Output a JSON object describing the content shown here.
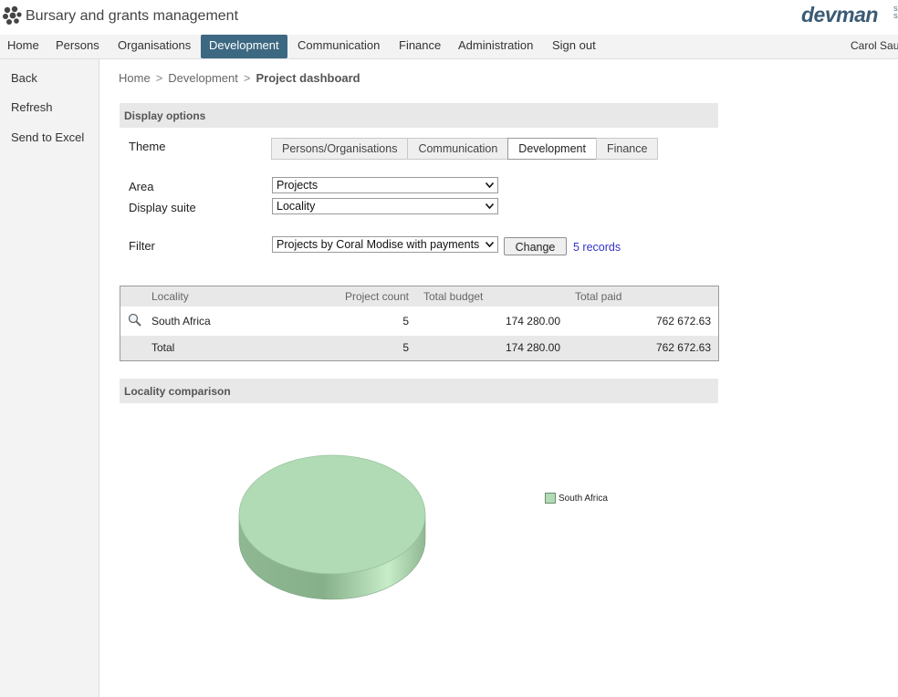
{
  "app": {
    "title": "Bursary and grants management",
    "brand": "devman",
    "brand_suffix": "S S"
  },
  "nav": {
    "items": [
      {
        "label": "Home",
        "active": false
      },
      {
        "label": "Persons",
        "active": false
      },
      {
        "label": "Organisations",
        "active": false
      },
      {
        "label": "Development",
        "active": true
      },
      {
        "label": "Communication",
        "active": false
      },
      {
        "label": "Finance",
        "active": false
      },
      {
        "label": "Administration",
        "active": false
      },
      {
        "label": "Sign out",
        "active": false
      }
    ],
    "user": "Carol Sau"
  },
  "sidebar": {
    "items": [
      "Back",
      "Refresh",
      "Send to Excel"
    ]
  },
  "breadcrumb": {
    "items": [
      "Home",
      "Development"
    ],
    "current": "Project dashboard",
    "separator": ">"
  },
  "display_options": {
    "header": "Display options",
    "theme_label": "Theme",
    "tabs": [
      {
        "label": "Persons/Organisations",
        "active": false
      },
      {
        "label": "Communication",
        "active": false
      },
      {
        "label": "Development",
        "active": true
      },
      {
        "label": "Finance",
        "active": false
      }
    ],
    "area_label": "Area",
    "area_value": "Projects",
    "suite_label": "Display suite",
    "suite_value": "Locality",
    "filter_label": "Filter",
    "filter_value": "Projects by Coral Modise with payments",
    "change_button": "Change",
    "records_link": "5 records"
  },
  "table": {
    "columns": [
      "Locality",
      "Project count",
      "Total budget",
      "Total paid"
    ],
    "rows": [
      {
        "locality": "South Africa",
        "count": "5",
        "budget": "174 280.00",
        "paid": "762 672.63"
      }
    ],
    "total": {
      "label": "Total",
      "count": "5",
      "budget": "174 280.00",
      "paid": "762 672.63"
    }
  },
  "comparison": {
    "header": "Locality comparison"
  },
  "chart_data": {
    "type": "pie",
    "style": "3d",
    "slices": [
      {
        "label": "South Africa",
        "value": 5,
        "color": "#b1dbb4"
      }
    ],
    "legend": {
      "entries": [
        "South Africa"
      ],
      "position": "right"
    }
  },
  "colors": {
    "nav_active": "#3d6882",
    "brand": "#3b5a74",
    "link": "#3333cc",
    "header_bg": "#e8e8e8"
  }
}
